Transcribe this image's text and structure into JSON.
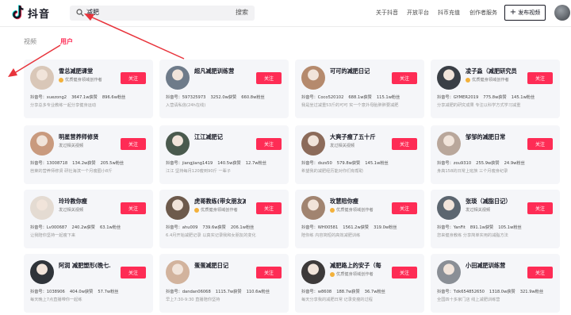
{
  "header": {
    "logo_text": "抖音",
    "search_value": "减肥",
    "search_button": "搜索",
    "nav": [
      "关于抖音",
      "开放平台",
      "抖币充值",
      "创作者服务"
    ],
    "publish_label": "发布视频"
  },
  "tabs": {
    "video": "视频",
    "user": "用户"
  },
  "colors": {
    "accent": "#fe2c55",
    "arrow": "#e8333b",
    "card_bg": "#f5f6f9"
  },
  "follow_label": "关注",
  "users": [
    {
      "name": "雪总减肥课堂",
      "sub": "优质健身领域创作者",
      "verified": true,
      "stats": [
        "抖音号：xuezong2",
        "3647.1w获赞",
        "896.6w粉丝"
      ],
      "desc": "分享总多专业教练一起分享健身运动",
      "avatar_color": "#d9c7b8"
    },
    {
      "name": "超凡减肥训练营",
      "sub": "",
      "verified": false,
      "stats": [
        "抖音号：597325973",
        "3252.0w获赞",
        "660.8w粉丝"
      ],
      "desc": "入营请私信(24h在线)",
      "avatar_color": "#6e7b8a"
    },
    {
      "name": "可可的减肥日记",
      "sub": "",
      "verified": false,
      "stats": [
        "抖音号：Coco520102",
        "688.1w获赞",
        "115.1w粉丝"
      ],
      "desc": "我是坐过减重53斤的可可 实一个意外母胎胖胖要减肥",
      "avatar_color": "#b58a6d"
    },
    {
      "name": "凌子淼（减肥研究员）",
      "sub": "优质健身领域创作者",
      "verified": true,
      "stats": [
        "抖音号：GYMER2019",
        "775.8w获赞",
        "145.1w粉丝"
      ],
      "desc": "分享减肥的研究成果 专注以科学方式学习减重",
      "avatar_color": "#3a3f46"
    },
    {
      "name": "明星营养师修贤",
      "sub": "发过相关视频",
      "verified": false,
      "stats": [
        "抖音号：13008718",
        "134.2w获赞",
        "205.5w粉丝"
      ],
      "desc": "芭莱的营养师修贤 研社海滨一个月瘦圈小8斤",
      "avatar_color": "#c99a7e"
    },
    {
      "name": "江江减肥记",
      "sub": "",
      "verified": false,
      "stats": [
        "抖音号：jiangjiang1419",
        "140.5w获赞",
        "12.7w粉丝"
      ],
      "desc": "江江 坚持每月120瘦到90斤 一辈子",
      "avatar_color": "#4a5a4e"
    },
    {
      "name": "大爽子瘦了五十斤",
      "sub": "发过相关视频",
      "verified": false,
      "stats": [
        "抖音号：dszs50",
        "579.8w获赞",
        "145.1w粉丝"
      ],
      "desc": "希望我的减肥经历能对你们有帮助",
      "avatar_color": "#8c6b5a"
    },
    {
      "name": "邹邹的减肥日常",
      "sub": "",
      "verified": false,
      "stats": [
        "抖音号：zou9310",
        "255.9w获赞",
        "24.9w粉丝"
      ],
      "desc": "身高158的日常上班族 三个月瘦身纪录",
      "avatar_color": "#b9a79b"
    },
    {
      "name": "玲玲教你瘦",
      "sub": "发过相关视频",
      "verified": false,
      "stats": [
        "抖音号：Lv000687",
        "240.2w获赞",
        "63.1w粉丝"
      ],
      "desc": "让我陪你坚持一起瘦下来",
      "avatar_color": "#e4dbd2"
    },
    {
      "name": "虎哥教练(带女朋友减...",
      "sub": "优质健身领域创作者",
      "verified": true,
      "stats": [
        "抖音号：ahu009",
        "739.6w获赞",
        "206.1w粉丝"
      ],
      "desc": "6.4月开始减肥记录 以真实记录我和女朋友的变化",
      "avatar_color": "#6d5a4c"
    },
    {
      "name": "玫慧陪你瘦",
      "sub": "优质健身领域创作者",
      "verified": true,
      "stats": [
        "抖音号：WH00581",
        "1561.2w获赞",
        "319.0w粉丝"
      ],
      "desc": "陪你练 内容简短的高效减肥训练",
      "avatar_color": "#a18470"
    },
    {
      "name": "张琰（减脂日记）",
      "sub": "发过相关视频",
      "verified": false,
      "stats": [
        "抖音号：YanFit",
        "891.1w获赞",
        "105.1w粉丝"
      ],
      "desc": "您来健身教练 分享简单实用的减脂方法",
      "avatar_color": "#5c6670"
    },
    {
      "name": "阿润 减肥塑形(晚七...",
      "sub": "",
      "verified": false,
      "stats": [
        "抖音号：1038906",
        "404.0w获赞",
        "57.7w粉丝"
      ],
      "desc": "每天晚上7点直播带你一起练",
      "avatar_color": "#2f343a"
    },
    {
      "name": "蛋蛋减肥日记",
      "sub": "",
      "verified": false,
      "stats": [
        "抖音号：dandan06068",
        "1115.7w获赞",
        "110.6w粉丝"
      ],
      "desc": "早上7:30-9:30 直播陪你坚持",
      "avatar_color": "#d2b39d"
    },
    {
      "name": "减肥路上的安子（每...",
      "sub": "优质健身领域创作者",
      "verified": true,
      "stats": [
        "抖音号：w8608",
        "188.7w获赞",
        "36.7w粉丝"
      ],
      "desc": "每天分享我的减肥日常 记录变瘦的过程",
      "avatar_color": "#3d3a3a"
    },
    {
      "name": "小田减肥训练营",
      "sub": "",
      "verified": false,
      "stats": [
        "抖音号：Tdk654852650",
        "1318.0w获赞",
        "321.9w粉丝"
      ],
      "desc": "全国四十多家门店 线上减肥训练营",
      "avatar_color": "#8a8f96"
    }
  ]
}
